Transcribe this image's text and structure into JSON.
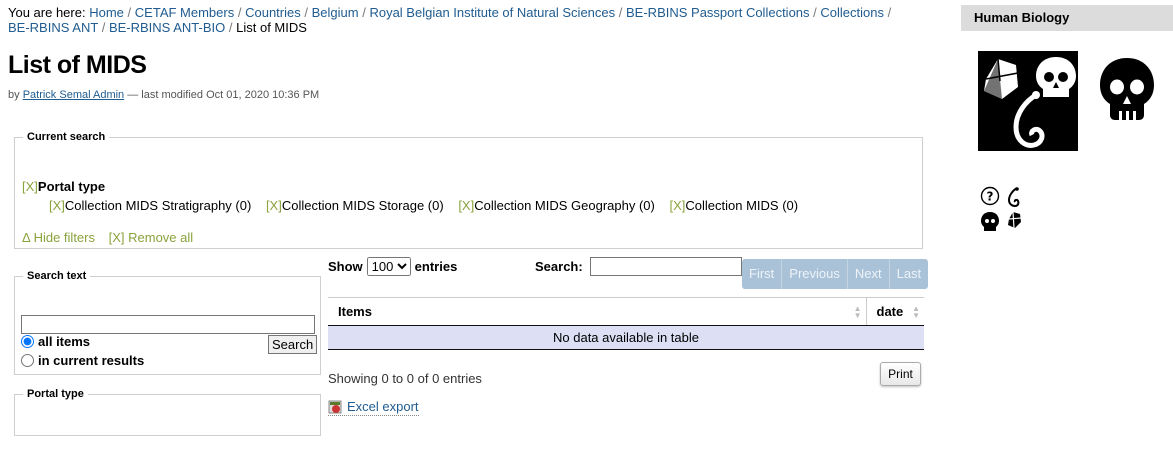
{
  "breadcrumb": {
    "prefix": "You are here:",
    "items": [
      "Home",
      "CETAF Members",
      "Countries",
      "Belgium",
      "Royal Belgian Institute of Natural Sciences",
      "BE-RBINS Passport Collections",
      "Collections",
      "BE-RBINS ANT",
      "BE-RBINS ANT-BIO"
    ],
    "current": "List of MIDS",
    "separator": "/"
  },
  "page": {
    "title": "List of MIDS",
    "byline_prefix": "by",
    "author": "Patrick Semal Admin",
    "modified": "— last modified Oct 01, 2020 10:36 PM"
  },
  "current_search": {
    "legend": "Current search",
    "x_marker": "[X]",
    "portal_type_label": "Portal type",
    "filters": [
      "Collection MIDS Stratigraphy (0)",
      "Collection MIDS Storage (0)",
      "Collection MIDS Geography (0)",
      "Collection MIDS (0)"
    ],
    "hide_filters": "Δ Hide filters",
    "remove_all": "[X] Remove all"
  },
  "search_text": {
    "legend": "Search text",
    "value": "",
    "button": "Search",
    "option_all": "all items",
    "option_current": "in current results",
    "selected": "all items"
  },
  "portal_type": {
    "legend": "Portal type"
  },
  "datatable": {
    "show_label": "Show",
    "entries_label": "entries",
    "page_length": "100",
    "search_label": "Search:",
    "search_value": "",
    "pager": [
      "First",
      "Previous",
      "Next",
      "Last"
    ],
    "columns": [
      "Items",
      "date"
    ],
    "empty_message": "No data available in table",
    "info": "Showing 0 to 0 of 0 entries",
    "print": "Print",
    "excel_export": "Excel export"
  },
  "portlet": {
    "title": "Human Biology",
    "icons": [
      "help-icon",
      "hook-icon",
      "skull-icon",
      "crystal-icon"
    ]
  }
}
